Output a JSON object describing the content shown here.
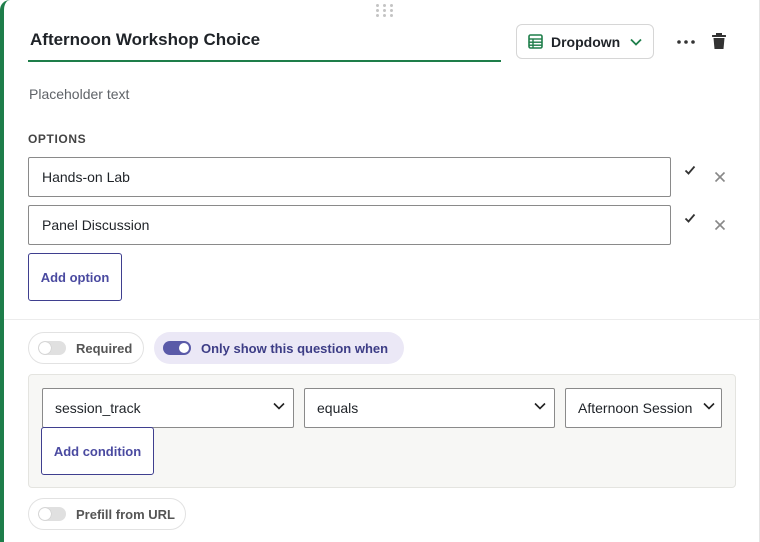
{
  "question": {
    "title": "Afternoon Workshop Choice",
    "type_label": "Dropdown",
    "placeholder_label": "Placeholder text"
  },
  "options": {
    "heading": "OPTIONS",
    "items": [
      {
        "value": "Hands-on Lab"
      },
      {
        "value": "Panel Discussion"
      }
    ],
    "add_label": "Add option"
  },
  "settings": {
    "required_label": "Required",
    "required_on": false,
    "conditional_label": "Only show this question when",
    "conditional_on": true,
    "prefill_label": "Prefill from URL",
    "prefill_on": false
  },
  "condition": {
    "field": "session_track",
    "operator": "equals",
    "value": "Afternoon Session",
    "add_label": "Add condition"
  },
  "colors": {
    "accent_green": "#1e7e4a",
    "accent_purple": "#4a4aa0"
  }
}
